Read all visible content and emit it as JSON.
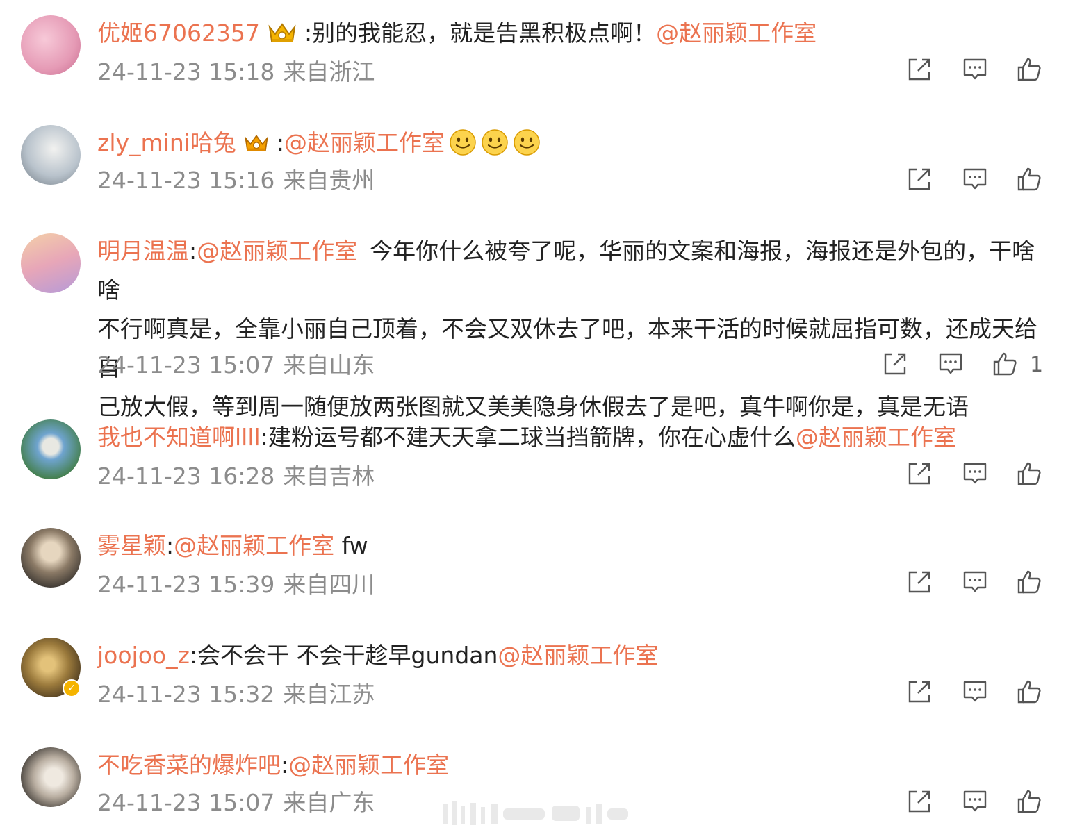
{
  "comments": [
    {
      "username": "优姬67062357",
      "sep": ":",
      "text": "别的我能忍，就是告黑积极点啊！",
      "mention": "@赵丽颖工作室",
      "time": "24-11-23 15:18",
      "location": "来自浙江",
      "avatar_colors": [
        "#f2b3c7",
        "#d8739a"
      ],
      "likes": ""
    },
    {
      "username": "zly_mini哈兔",
      "sep": ":",
      "mention": "@赵丽颖工作室",
      "time": "24-11-23 15:16",
      "location": "来自贵州",
      "avatar_colors": [
        "#c9d2dc",
        "#7d8790"
      ],
      "emojis": [
        "smile-emoji",
        "smile-emoji",
        "smile-emoji"
      ],
      "likes": ""
    },
    {
      "username": "明月温温",
      "sep": ":",
      "mention": "@赵丽颖工作室",
      "line1": "今年你什么被夸了呢，华丽的文案和海报，海报还是外包的，干啥啥",
      "line2": "不行啊真是，全靠小丽自己顶着，不会又双休去了吧，本来干活的时候就屈指可数，还成天给自",
      "line3": "己放大假，等到周一随便放两张图就又美美隐身休假去了是吧，真牛啊你是，真是无语",
      "time": "24-11-23 15:07",
      "location": "来自山东",
      "avatar_colors": [
        "#f3c9a1",
        "#c49ad8"
      ],
      "likes": "1"
    },
    {
      "username": "我也不知道啊llll",
      "sep": ":",
      "text": "建粉运号都不建天天拿二球当挡箭牌，你在心虚什么",
      "mention": "@赵丽颖工作室",
      "time": "24-11-23 16:28",
      "location": "来自吉林",
      "avatar_colors": [
        "#7fb3d8",
        "#4f8a3a"
      ],
      "likes": ""
    },
    {
      "username": "雾星颖",
      "sep": ":",
      "mention": "@赵丽颖工作室",
      "text_after": " fw",
      "time": "24-11-23 15:39",
      "location": "来自四川",
      "avatar_colors": [
        "#c7b49a",
        "#3d3a36"
      ],
      "likes": ""
    },
    {
      "username": "joojoo_z",
      "sep": ":",
      "text": "会不会干 不会干趁早gundan",
      "mention": "@赵丽颖工作室",
      "time": "24-11-23 15:32",
      "location": "来自江苏",
      "avatar_colors": [
        "#c9a15a",
        "#4c3a22"
      ],
      "likes": ""
    },
    {
      "username": "不吃香菜的爆炸吧",
      "sep": ":",
      "mention": "@赵丽颖工作室",
      "time": "24-11-23 15:07",
      "location": "来自广东",
      "avatar_colors": [
        "#d8d2c8",
        "#3a3530"
      ],
      "likes": ""
    }
  ],
  "icons": {
    "share": "share-icon",
    "comment": "comment-icon",
    "like": "like-icon"
  },
  "colors": {
    "username": "#eb7350",
    "meta": "#8c8c8c",
    "icon": "#555555"
  }
}
